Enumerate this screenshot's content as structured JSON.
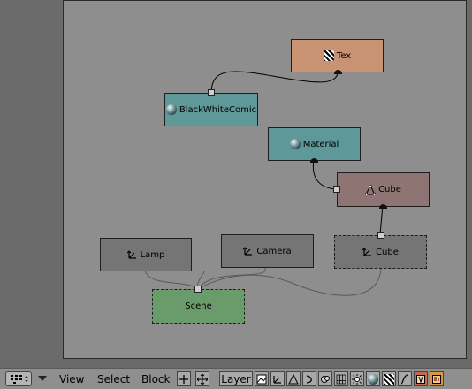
{
  "nodes": {
    "tex": {
      "label": "Tex"
    },
    "blackwhitecomic": {
      "label": "BlackWhiteComic"
    },
    "material": {
      "label": "Material"
    },
    "cube_mesh": {
      "label": "Cube"
    },
    "lamp": {
      "label": "Lamp"
    },
    "camera": {
      "label": "Camera"
    },
    "cube_object": {
      "label": "Cube"
    },
    "scene": {
      "label": "Scene"
    }
  },
  "toolbar": {
    "menu_view": "View",
    "menu_select": "Select",
    "menu_block": "Block",
    "layer_label": "Layer"
  },
  "colors": {
    "texture_node": "#c99373",
    "world_node": "#5e9899",
    "material_node": "#5e9899",
    "mesh_node": "#8f7474",
    "object_node": "#757575",
    "scene_node": "#6a9b6a",
    "canvas": "#8e8e8e"
  }
}
